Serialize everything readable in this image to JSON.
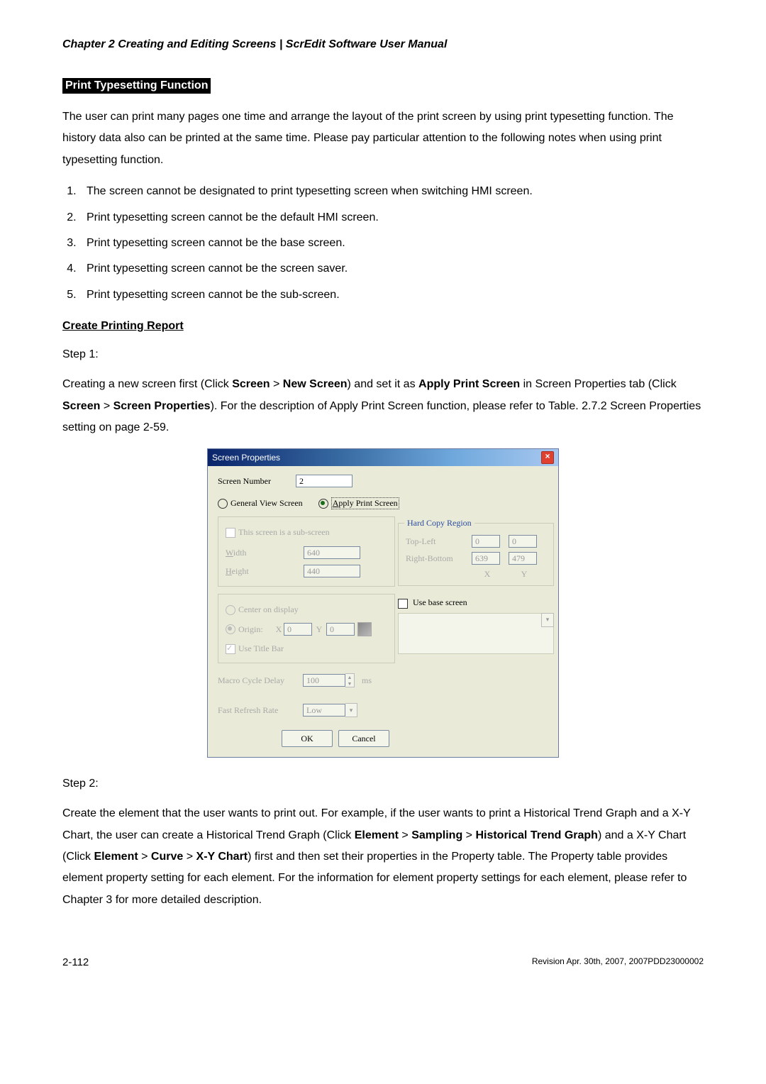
{
  "header": {
    "chapter": "Chapter 2  Creating and Editing Screens |  ScrEdit Software User Manual"
  },
  "section_title": "Print Typesetting Function",
  "intro": "The user can print many pages one time and arrange the layout of the print screen by using print typesetting function. The history data also can be printed at the same time. Please pay particular attention to the following notes when using print typesetting function.",
  "notes": [
    "The screen cannot be designated to print typesetting screen when switching HMI screen.",
    "Print typesetting screen cannot be the default HMI screen.",
    "Print typesetting screen cannot be the base screen.",
    "Print typesetting screen cannot be the screen saver.",
    "Print typesetting screen cannot be the sub-screen."
  ],
  "subsection": "Create Printing Report",
  "step1_label": "Step 1:",
  "step1_text": {
    "t1": "Creating a new screen first (Click ",
    "b1": "Screen",
    "t2": " > ",
    "b2": "New Screen",
    "t3": ") and set it as ",
    "b3": "Apply Print Screen",
    "t4": " in Screen Properties tab (Click ",
    "b4": "Screen",
    "t5": " > ",
    "b5": "Screen Properties",
    "t6": "). For the description of Apply Print Screen function, please refer to Table. 2.7.2 Screen Properties setting on page 2-59."
  },
  "dialog": {
    "title": "Screen Properties",
    "screen_number_label": "Screen Number",
    "screen_number_value": "2",
    "general_view": "General View Screen",
    "apply_print_a": "A",
    "apply_print_rest": "pply Print Screen",
    "sub_screen": "This screen is a sub-screen",
    "width_u": "W",
    "width_rest": "idth",
    "width_value": "640",
    "height_u": "H",
    "height_rest": "eight",
    "height_value": "440",
    "center": "Center on display",
    "origin": "Origin:",
    "x_label": "X",
    "x_value": "0",
    "y_label": "Y",
    "y_value": "0",
    "use_title_bar": "Use Title Bar",
    "macro_label": "Macro Cycle Delay",
    "macro_value": "100",
    "macro_unit": "ms",
    "refresh_label": "Fast Refresh Rate",
    "refresh_value": "Low",
    "hardcopy_legend": "Hard Copy Region",
    "top_left": "Top-Left",
    "tl_x": "0",
    "tl_y": "0",
    "right_bottom": "Right-Bottom",
    "rb_x": "639",
    "rb_y": "479",
    "axis_x": "X",
    "axis_y": "Y",
    "use_base": "Use base screen",
    "ok": "OK",
    "cancel": "Cancel"
  },
  "step2_label": "Step 2:",
  "step2_text": {
    "t1": "Create the element that the user wants to print out. For example, if the user wants to print a Historical Trend Graph and a X-Y Chart, the user can create a Historical Trend Graph (Click ",
    "b1": "Element",
    "t2": " > ",
    "b2": "Sampling",
    "t3": " > ",
    "b3": "Historical Trend Graph",
    "t4": ") and a X-Y Chart (Click ",
    "b4": "Element",
    "t5": " > ",
    "b5": "Curve",
    "t6": " > ",
    "b6": "X-Y Chart",
    "t7": ") first and then set their properties in the Property table. The Property table provides element property setting for each element. For the information for element property settings for each element, please refer to Chapter 3 for more detailed description."
  },
  "footer": {
    "page": "2-112",
    "revision": "Revision Apr. 30th, 2007, 2007PDD23000002"
  }
}
